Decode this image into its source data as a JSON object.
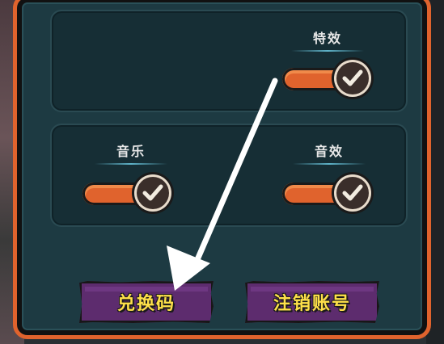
{
  "settings": {
    "effects_label": "特效",
    "music_label": "音乐",
    "sound_label": "音效"
  },
  "toggles": {
    "effects_on": true,
    "music_on": true,
    "sound_on": true
  },
  "buttons": {
    "redeem_label": "兑换码",
    "logout_label": "注销账号"
  },
  "colors": {
    "frame": "#e0632d",
    "toggle_on": "#e0632d",
    "button_bg": "#5d2c6e",
    "button_text": "#ffe14a"
  }
}
